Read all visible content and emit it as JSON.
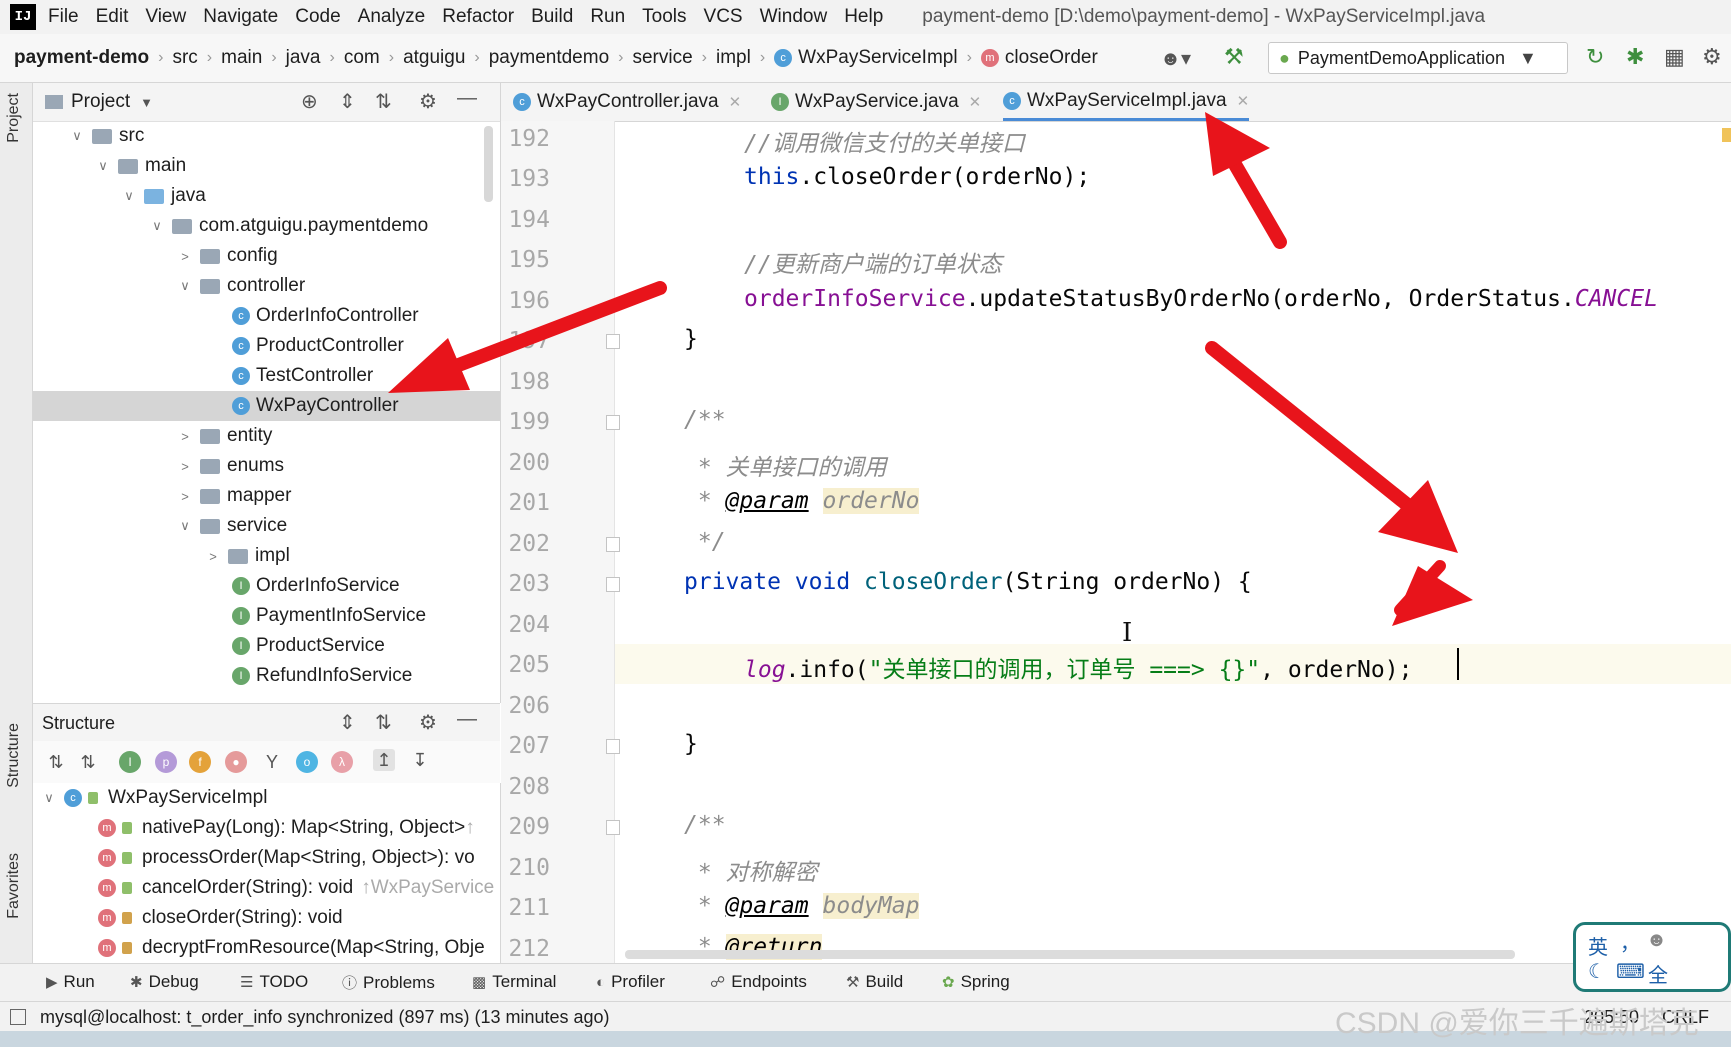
{
  "menubar": {
    "logo": "IJ",
    "items": [
      "File",
      "Edit",
      "View",
      "Navigate",
      "Code",
      "Analyze",
      "Refactor",
      "Build",
      "Run",
      "Tools",
      "VCS",
      "Window",
      "Help"
    ],
    "title": "payment-demo [D:\\demo\\payment-demo] - WxPayServiceImpl.java"
  },
  "navbar": {
    "project": "payment-demo",
    "crumbs": [
      "src",
      "main",
      "java",
      "com",
      "atguigu",
      "paymentdemo",
      "service",
      "impl",
      "WxPayServiceImpl",
      "closeOrder"
    ],
    "run_config": "PaymentDemoApplication"
  },
  "left_strip": {
    "project": "Project",
    "structure": "Structure",
    "favorites": "Favorites"
  },
  "project_panel": {
    "title": "Project",
    "tree": [
      {
        "label": "src",
        "type": "folder"
      },
      {
        "label": "main",
        "type": "folder"
      },
      {
        "label": "java",
        "type": "folder"
      },
      {
        "label": "com.atguigu.paymentdemo",
        "type": "package"
      },
      {
        "label": "config",
        "type": "package"
      },
      {
        "label": "controller",
        "type": "package"
      },
      {
        "label": "OrderInfoController",
        "type": "class"
      },
      {
        "label": "ProductController",
        "type": "class"
      },
      {
        "label": "TestController",
        "type": "class"
      },
      {
        "label": "WxPayController",
        "type": "class"
      },
      {
        "label": "entity",
        "type": "package"
      },
      {
        "label": "enums",
        "type": "package"
      },
      {
        "label": "mapper",
        "type": "package"
      },
      {
        "label": "service",
        "type": "package"
      },
      {
        "label": "impl",
        "type": "package"
      },
      {
        "label": "OrderInfoService",
        "type": "interface"
      },
      {
        "label": "PaymentInfoService",
        "type": "interface"
      },
      {
        "label": "ProductService",
        "type": "interface"
      },
      {
        "label": "RefundInfoService",
        "type": "interface"
      }
    ]
  },
  "structure_panel": {
    "title": "Structure",
    "root": "WxPayServiceImpl",
    "members": [
      {
        "sig": "nativePay(Long): Map<String, Object>",
        "extra": "↑"
      },
      {
        "sig": "processOrder(Map<String, Object>): vo",
        "extra": ""
      },
      {
        "sig": "cancelOrder(String): void",
        "extra": "↑WxPayService"
      },
      {
        "sig": "closeOrder(String): void",
        "extra": ""
      },
      {
        "sig": "decryptFromResource(Map<String, Obje",
        "extra": ""
      }
    ]
  },
  "editor": {
    "tabs": [
      {
        "label": "WxPayController.java",
        "badge": "c"
      },
      {
        "label": "WxPayService.java",
        "badge": "i"
      },
      {
        "label": "WxPayServiceImpl.java",
        "badge": "c"
      }
    ],
    "line_numbers": [
      "192",
      "193",
      "194",
      "195",
      "196",
      "197",
      "198",
      "199",
      "200",
      "201",
      "202",
      "203",
      "204",
      "205",
      "206",
      "207",
      "208",
      "209",
      "210",
      "211",
      "212"
    ],
    "lines": {
      "l192": "//调用微信支付的关单接口",
      "l193_this": "this",
      "l193_rest": ".closeOrder(orderNo);",
      "l195": "//更新商户端的订单状态",
      "l196_field": "orderInfoService",
      "l196_rest": ".updateStatusByOrderNo(orderNo, OrderStatus.",
      "l196_enum": "CANCEL",
      "l197": "}",
      "l199": "/**",
      "l200": " * 关单接口的调用",
      "l201_star": " * ",
      "l201_tag": "@param",
      "l201_name": "orderNo",
      "l202": " */",
      "l203_kw": "private void ",
      "l203_fn": "closeOrder",
      "l203_rest": "(String orderNo) {",
      "l205_field": "log",
      "l205_call": ".info(",
      "l205_str": "\"关单接口的调用，订单号 ===> {}\"",
      "l205_rest": ", orderNo);",
      "l207": "}",
      "l209": "/**",
      "l210": " * 对称解密",
      "l211_star": " * ",
      "l211_tag": "@param",
      "l211_name": "bodyMap",
      "l212_star": " * ",
      "l212_tag": "@return"
    }
  },
  "bottom_tools": [
    "Run",
    "Debug",
    "TODO",
    "Problems",
    "Terminal",
    "Profiler",
    "Endpoints",
    "Build",
    "Spring"
  ],
  "status": {
    "message": "mysql@localhost: t_order_info synchronized (897 ms) (13 minutes ago)",
    "position": "205:50",
    "line_sep": "CRLF"
  },
  "ime": {
    "lang": "英",
    "punct": "，",
    "mode": "全"
  },
  "watermark": "CSDN @爱你三千遍斯塔克",
  "colors": {
    "annotation_arrow": "#e8141b",
    "accent": "#4a8bd6"
  }
}
